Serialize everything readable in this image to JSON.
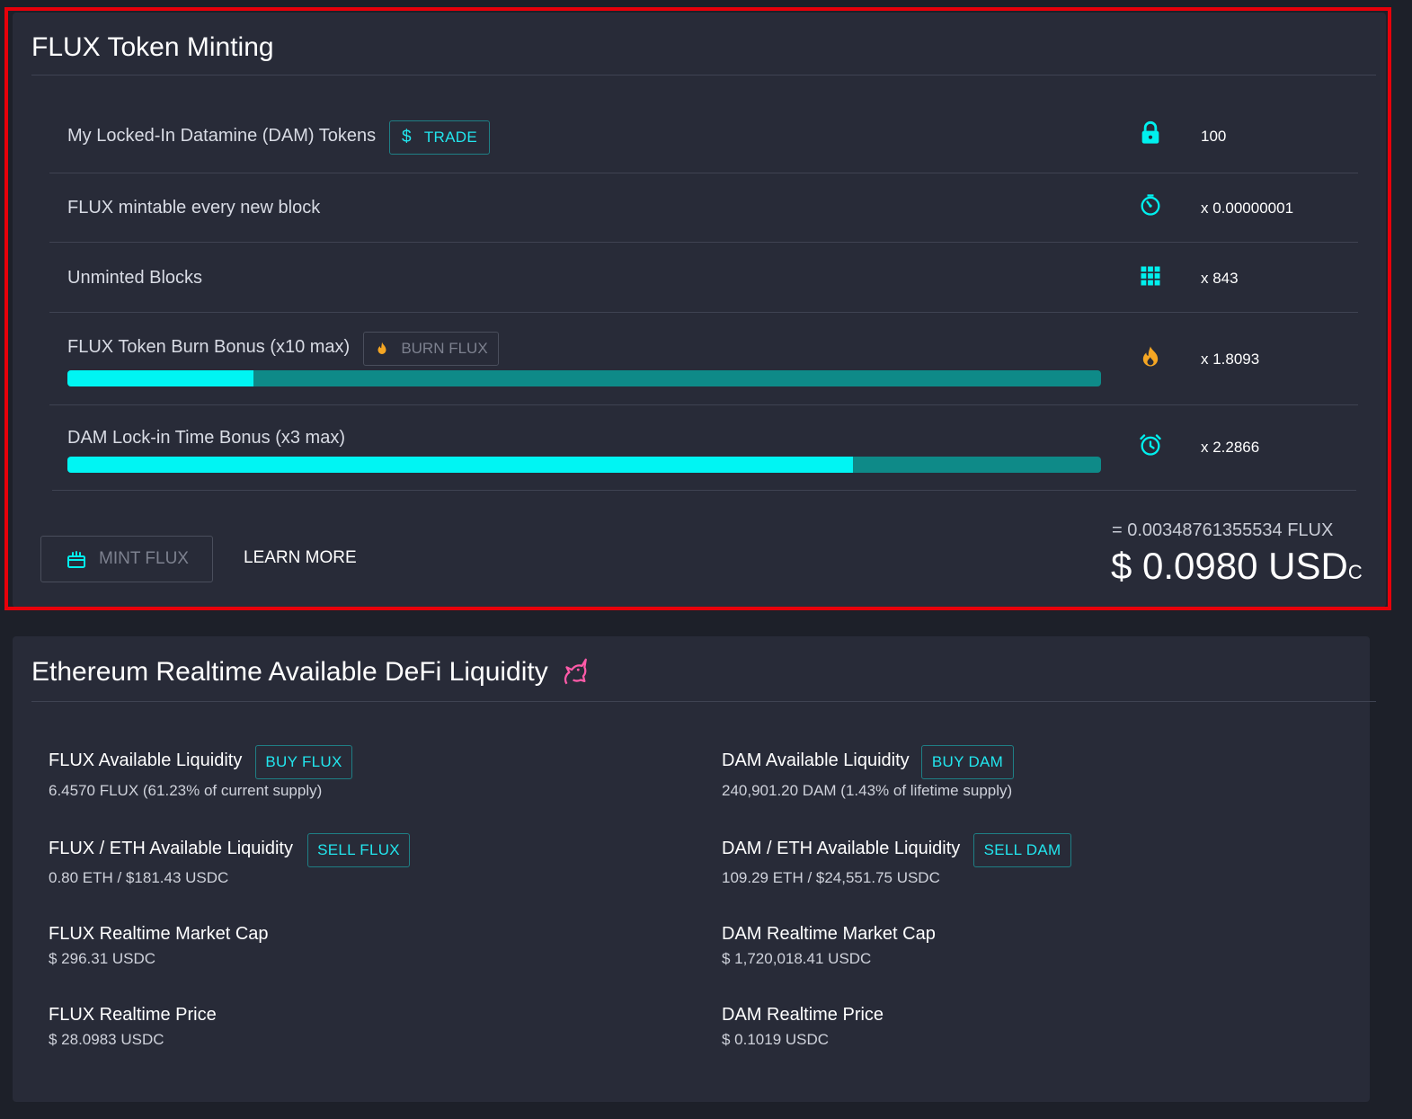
{
  "minting": {
    "title": "FLUX Token Minting",
    "rows": {
      "locked": {
        "label": "My Locked-In Datamine (DAM) Tokens",
        "button": "TRADE",
        "button_icon": "dollar-icon",
        "icon": "lock-icon",
        "value": "100"
      },
      "mintable": {
        "label": "FLUX mintable every new block",
        "icon": "timer-icon",
        "value": "x 0.00000001"
      },
      "unminted": {
        "label": "Unminted Blocks",
        "icon": "grid-icon",
        "value": "x 843"
      },
      "burn": {
        "label": "FLUX Token Burn Bonus (x10 max)",
        "button": "BURN FLUX",
        "button_icon": "flame-icon",
        "icon": "flame-icon",
        "value": "x 1.8093",
        "progress": 0.18
      },
      "lockin": {
        "label": "DAM Lock-in Time Bonus (x3 max)",
        "icon": "alarm-clock-icon",
        "value": "x 2.2866",
        "progress": 0.76
      }
    },
    "mint_button": "MINT FLUX",
    "learn_more": "LEARN MORE",
    "flux_amount": "= 0.00348761355534 FLUX",
    "usd_amount": "$ 0.0980 USD",
    "usd_suffix": "C"
  },
  "liquidity": {
    "title": "Ethereum Realtime Available DeFi Liquidity",
    "title_icon": "unicorn-icon",
    "left": [
      {
        "label": "FLUX Available Liquidity",
        "button": "BUY FLUX",
        "value": "6.4570 FLUX (61.23% of current supply)"
      },
      {
        "label": "FLUX / ETH Available Liquidity",
        "button": "SELL FLUX",
        "value": "0.80 ETH / $181.43 USDC"
      },
      {
        "label": "FLUX Realtime Market Cap",
        "value": "$ 296.31 USDC"
      },
      {
        "label": "FLUX Realtime Price",
        "value": "$ 28.0983 USDC"
      }
    ],
    "right": [
      {
        "label": "DAM Available Liquidity",
        "button": "BUY DAM",
        "value": "240,901.20 DAM (1.43% of lifetime supply)"
      },
      {
        "label": "DAM / ETH Available Liquidity",
        "button": "SELL DAM",
        "value": "109.29 ETH / $24,551.75 USDC"
      },
      {
        "label": "DAM Realtime Market Cap",
        "value": "$ 1,720,018.41 USDC"
      },
      {
        "label": "DAM Realtime Price",
        "value": "$ 0.1019 USDC"
      }
    ]
  },
  "colors": {
    "accent": "#00f5f3",
    "accent_dark": "#0e8a88",
    "flame": "#f5a623",
    "highlight": "#e8000a",
    "panel": "#282b38"
  }
}
